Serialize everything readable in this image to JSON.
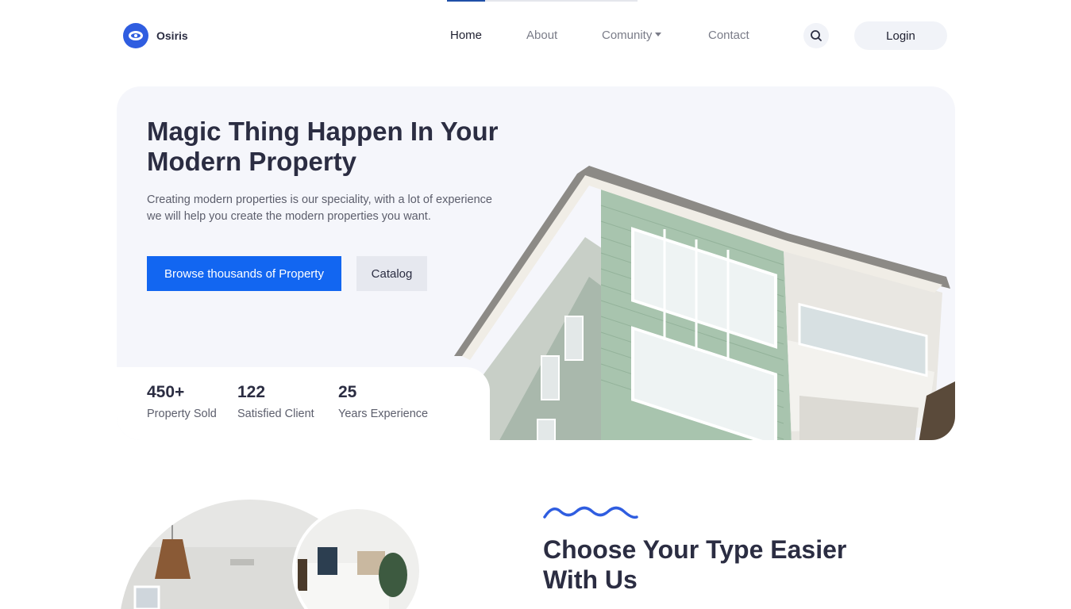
{
  "brand": {
    "name": "Osiris",
    "logo_icon": "eye-logo-icon",
    "accent": "#2f5de0"
  },
  "nav": {
    "links": [
      {
        "label": "Home",
        "active": true
      },
      {
        "label": "About",
        "active": false
      },
      {
        "label": "Comunity",
        "active": false,
        "dropdown": true
      },
      {
        "label": "Contact",
        "active": false
      }
    ],
    "search_icon": "search-icon",
    "login_label": "Login"
  },
  "hero": {
    "title_line1": "Magic Thing Happen In Your",
    "title_line2": "Modern Property",
    "description_line1": "Creating modern properties is our speciality, with a lot of experience",
    "description_line2": "we will help you create the modern properties you want.",
    "primary_button": "Browse thousands of Property",
    "secondary_button": "Catalog",
    "primary_color": "#1266f1"
  },
  "stats": [
    {
      "value": "450+",
      "label": "Property Sold"
    },
    {
      "value": "122",
      "label": "Satisfied Client"
    },
    {
      "value": "25",
      "label": "Years Experience"
    }
  ],
  "section2": {
    "title_line1": "Choose Your Type Easier",
    "title_line2": "With Us",
    "wave_icon": "wave-decoration-icon"
  }
}
